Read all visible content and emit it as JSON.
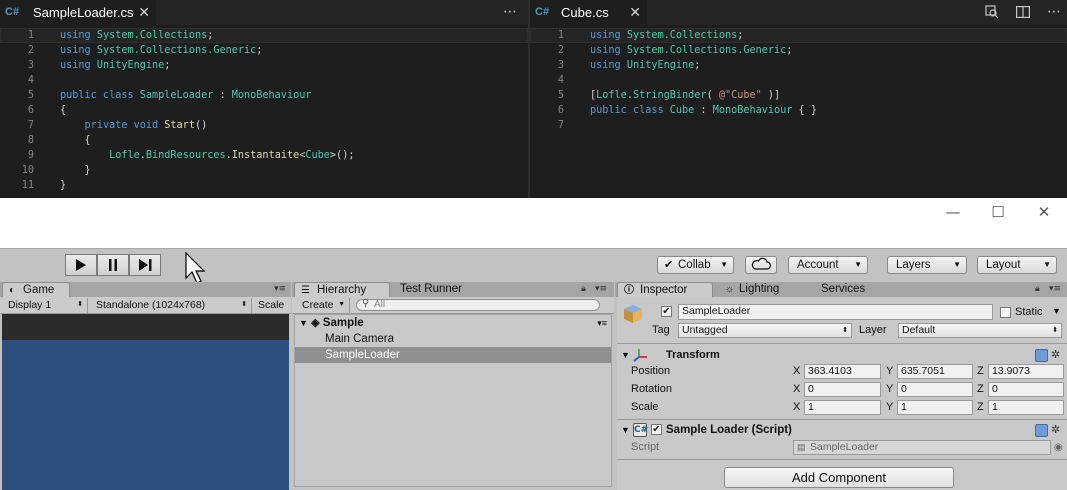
{
  "editor_left": {
    "tab_label": "SampleLoader.cs",
    "tab_icon": "csharp-icon",
    "lines": [
      {
        "num": "1",
        "parts": [
          [
            "kw",
            "using "
          ],
          [
            "ty",
            "System.Collections"
          ],
          [
            "pl",
            ";"
          ]
        ]
      },
      {
        "num": "2",
        "parts": [
          [
            "kw",
            "using "
          ],
          [
            "ty",
            "System.Collections.Generic"
          ],
          [
            "pl",
            ";"
          ]
        ]
      },
      {
        "num": "3",
        "parts": [
          [
            "kw",
            "using "
          ],
          [
            "ty",
            "UnityEngine"
          ],
          [
            "pl",
            ";"
          ]
        ]
      },
      {
        "num": "4",
        "parts": []
      },
      {
        "num": "5",
        "parts": [
          [
            "kw",
            "public class "
          ],
          [
            "ty",
            "SampleLoader"
          ],
          [
            "pl",
            " : "
          ],
          [
            "ty",
            "MonoBehaviour"
          ]
        ]
      },
      {
        "num": "6",
        "parts": [
          [
            "pl",
            "{"
          ]
        ]
      },
      {
        "num": "7",
        "parts": [
          [
            "pl",
            "    "
          ],
          [
            "kw",
            "private void "
          ],
          [
            "fn",
            "Start"
          ],
          [
            "pl",
            "()"
          ]
        ]
      },
      {
        "num": "8",
        "parts": [
          [
            "pl",
            "    {"
          ]
        ]
      },
      {
        "num": "9",
        "parts": [
          [
            "pl",
            "        "
          ],
          [
            "ty",
            "Lofle"
          ],
          [
            "pl",
            "."
          ],
          [
            "ty",
            "BindResources"
          ],
          [
            "pl",
            "."
          ],
          [
            "fn",
            "Instantaite"
          ],
          [
            "pl",
            "<"
          ],
          [
            "ty",
            "Cube"
          ],
          [
            "pl",
            ">();"
          ]
        ]
      },
      {
        "num": "10",
        "parts": [
          [
            "pl",
            "    }"
          ]
        ]
      },
      {
        "num": "11",
        "parts": [
          [
            "pl",
            "}"
          ]
        ]
      }
    ]
  },
  "editor_right": {
    "tab_label": "Cube.cs",
    "tab_icon": "csharp-icon",
    "lines": [
      {
        "num": "1",
        "parts": [
          [
            "kw",
            "using "
          ],
          [
            "ty",
            "System.Collections"
          ],
          [
            "pl",
            ";"
          ]
        ]
      },
      {
        "num": "2",
        "parts": [
          [
            "kw",
            "using "
          ],
          [
            "ty",
            "System.Collections.Generic"
          ],
          [
            "pl",
            ";"
          ]
        ]
      },
      {
        "num": "3",
        "parts": [
          [
            "kw",
            "using "
          ],
          [
            "ty",
            "UnityEngine"
          ],
          [
            "pl",
            ";"
          ]
        ]
      },
      {
        "num": "4",
        "parts": []
      },
      {
        "num": "5",
        "parts": [
          [
            "pl",
            "["
          ],
          [
            "ty",
            "Lofle"
          ],
          [
            "pl",
            "."
          ],
          [
            "ty",
            "StringBinder"
          ],
          [
            "pl",
            "( "
          ],
          [
            "str",
            "@\"Cube\""
          ],
          [
            "pl",
            " )]"
          ]
        ]
      },
      {
        "num": "6",
        "parts": [
          [
            "kw",
            "public class "
          ],
          [
            "ty",
            "Cube"
          ],
          [
            "pl",
            " : "
          ],
          [
            "ty",
            "MonoBehaviour"
          ],
          [
            "pl",
            " { }"
          ]
        ]
      },
      {
        "num": "7",
        "parts": []
      }
    ]
  },
  "toolbar": {
    "collab_label": "Collab",
    "account_label": "Account",
    "layers_label": "Layers",
    "layout_label": "Layout"
  },
  "game_panel": {
    "tab_label": "Game",
    "display_label": "Display 1",
    "resolution_label": "Standalone (1024x768)",
    "scale_label": "Scale"
  },
  "hierarchy_panel": {
    "tab_label": "Hierarchy",
    "tab2_label": "Test Runner",
    "create_label": "Create",
    "search_placeholder": "All",
    "scene_name": "Sample",
    "items": [
      "Main Camera",
      "SampleLoader"
    ],
    "selected_item": "SampleLoader"
  },
  "inspector_panel": {
    "tab_label": "Inspector",
    "tab2_label": "Lighting",
    "tab3_label": "Services",
    "object_name": "SampleLoader",
    "static_label": "Static",
    "tag_label": "Tag",
    "tag_value": "Untagged",
    "layer_label": "Layer",
    "layer_value": "Default",
    "transform": {
      "title": "Transform",
      "rows": [
        {
          "label": "Position",
          "x": "363.4103",
          "y": "635.7051",
          "z": "13.9073"
        },
        {
          "label": "Rotation",
          "x": "0",
          "y": "0",
          "z": "0"
        },
        {
          "label": "Scale",
          "x": "1",
          "y": "1",
          "z": "1"
        }
      ],
      "axis_x": "X",
      "axis_y": "Y",
      "axis_z": "Z"
    },
    "script_component": {
      "title": "Sample Loader (Script)",
      "script_label": "Script",
      "script_value": "SampleLoader"
    },
    "add_component_label": "Add Component"
  },
  "colors": {
    "editor_bg": "#1e1e1e",
    "keyword": "#569cd6",
    "type": "#4ec9b0",
    "unity_panel": "#c2c2c2",
    "game_view": "#2d4f80",
    "selection": "#8f8f8f"
  }
}
